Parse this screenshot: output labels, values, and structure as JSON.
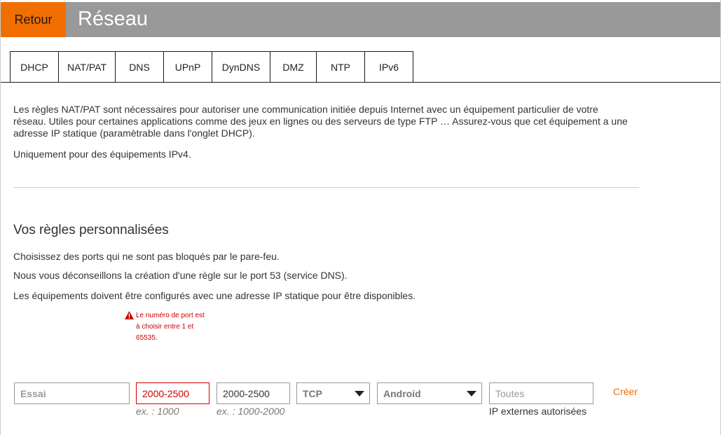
{
  "header": {
    "back_label": "Retour",
    "title": "Réseau",
    "colors": {
      "bar": "#999999",
      "back": "#f16e00"
    }
  },
  "tabs": [
    {
      "label": "DHCP"
    },
    {
      "label": "NAT/PAT",
      "active": true
    },
    {
      "label": "DNS"
    },
    {
      "label": "UPnP"
    },
    {
      "label": "DynDNS"
    },
    {
      "label": "DMZ"
    },
    {
      "label": "NTP"
    },
    {
      "label": "IPv6"
    }
  ],
  "intro": {
    "description": "Les règles NAT/PAT sont nécessaires pour autoriser une communication initiée depuis Internet avec un équipement particulier de votre réseau. Utiles pour certaines applications comme des jeux en lignes ou des serveurs de type FTP … Assurez-vous que cet équipement a une adresse IP statique (paramètrable dans l'onglet DHCP).",
    "ipv4_note": "Uniquement pour des équipements IPv4."
  },
  "rules": {
    "title": "Vos règles personnalisées",
    "lines": [
      "Choisissez des ports qui ne sont pas bloqués par le pare-feu.",
      "Nous vous déconseillons la création d'une règle sur le port 53 (service DNS).",
      "Les équipements doivent être configurés avec une adresse IP statique pour être disponibles."
    ],
    "error": "Le numéro de port est à choisir entre 1 et 65535.",
    "form": {
      "name_placeholder": "Essai",
      "internal_port_value": "2000-2500",
      "internal_port_hint": "ex. : 1000",
      "external_port_value": "2000-2500",
      "external_port_hint": "ex. : 1000-2000",
      "protocol_value": "TCP",
      "device_value": "Android",
      "external_ip_placeholder": "Toutes",
      "external_ip_hint": "IP externes autorisées",
      "create_label": "Créer"
    }
  }
}
